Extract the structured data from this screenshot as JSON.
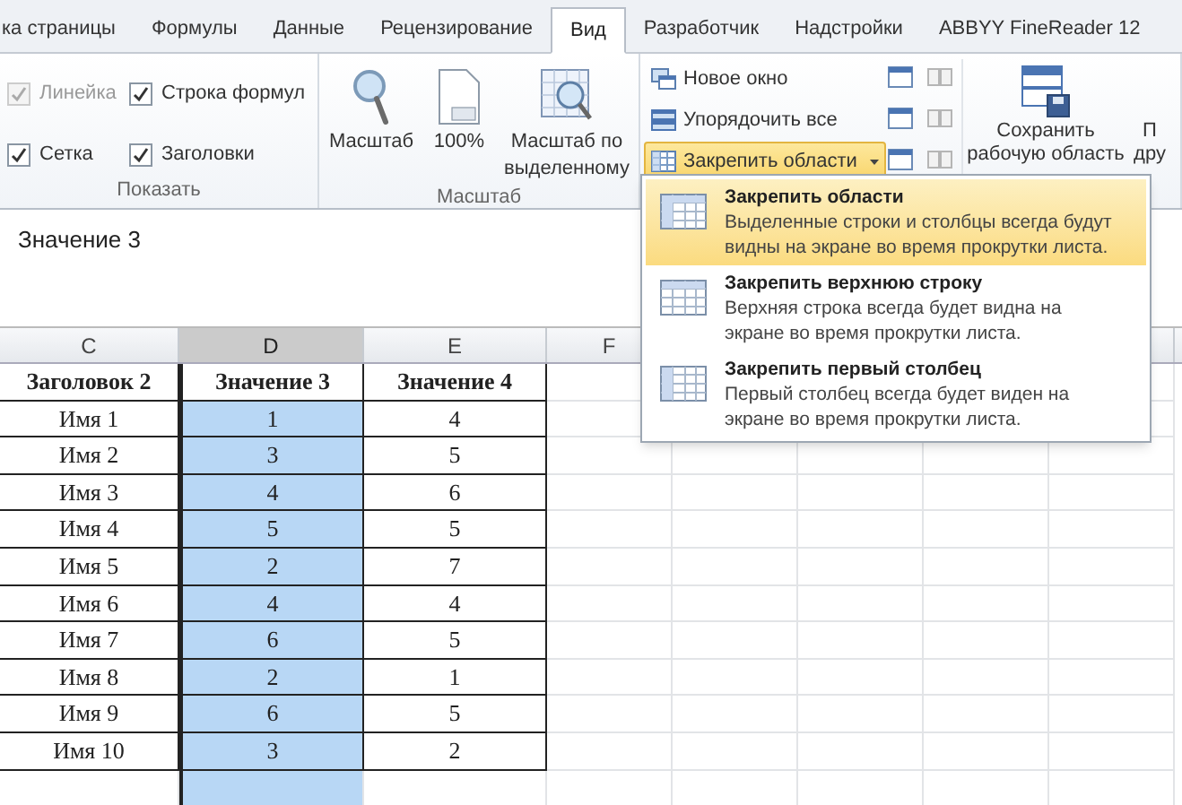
{
  "tabs": [
    {
      "label": "ка страницы",
      "selected": false
    },
    {
      "label": "Формулы",
      "selected": false
    },
    {
      "label": "Данные",
      "selected": false
    },
    {
      "label": "Рецензирование",
      "selected": false
    },
    {
      "label": "Вид",
      "selected": true
    },
    {
      "label": "Разработчик",
      "selected": false
    },
    {
      "label": "Надстройки",
      "selected": false
    },
    {
      "label": "ABBYY FineReader 12",
      "selected": false
    }
  ],
  "show_group": {
    "label": "Показать",
    "checkboxes": [
      {
        "label": "Линейка",
        "checked": true,
        "disabled": true
      },
      {
        "label": "Строка формул",
        "checked": true,
        "disabled": false
      },
      {
        "label": "Сетка",
        "checked": true,
        "disabled": false
      },
      {
        "label": "Заголовки",
        "checked": true,
        "disabled": false
      }
    ]
  },
  "zoom_group": {
    "label": "Масштаб",
    "buttons": [
      {
        "kind": "magnifier",
        "label": "Масштаб"
      },
      {
        "kind": "page",
        "label": "100%"
      },
      {
        "kind": "selection",
        "label": "Масштаб по выделенному"
      }
    ]
  },
  "window_group": {
    "buttons": [
      {
        "kind": "new-window",
        "label": "Новое окно",
        "pressed": false,
        "dropdown": false
      },
      {
        "kind": "arrange",
        "label": "Упорядочить все",
        "pressed": false,
        "dropdown": false
      },
      {
        "kind": "freeze",
        "label": "Закрепить области",
        "pressed": true,
        "dropdown": true
      }
    ],
    "large_buttons": [
      {
        "label": "Сохранить рабочую область"
      },
      {
        "label": "П дру"
      }
    ]
  },
  "formula_bar": {
    "value": "Значение 3"
  },
  "sheet": {
    "columns": [
      {
        "label": "C",
        "selected": false
      },
      {
        "label": "D",
        "selected": true
      },
      {
        "label": "E",
        "selected": false
      },
      {
        "label": "F",
        "selected": false
      }
    ],
    "rows": [
      {
        "kind": "header",
        "cells": [
          "Заголовок 2",
          "Значение 3",
          "Значение 4"
        ]
      },
      {
        "kind": "data",
        "cells": [
          "Имя 1",
          "1",
          "4"
        ]
      },
      {
        "kind": "data",
        "cells": [
          "Имя 2",
          "3",
          "5"
        ]
      },
      {
        "kind": "data",
        "cells": [
          "Имя 3",
          "4",
          "6"
        ]
      },
      {
        "kind": "data",
        "cells": [
          "Имя 4",
          "5",
          "5"
        ]
      },
      {
        "kind": "data",
        "cells": [
          "Имя 5",
          "2",
          "7"
        ]
      },
      {
        "kind": "data",
        "cells": [
          "Имя 6",
          "4",
          "4"
        ]
      },
      {
        "kind": "data",
        "cells": [
          "Имя 7",
          "6",
          "5"
        ]
      },
      {
        "kind": "data",
        "cells": [
          "Имя 8",
          "2",
          "1"
        ]
      },
      {
        "kind": "data",
        "cells": [
          "Имя 9",
          "6",
          "5"
        ]
      },
      {
        "kind": "data",
        "cells": [
          "Имя 10",
          "3",
          "2"
        ]
      },
      {
        "kind": "empty",
        "cells": []
      }
    ]
  },
  "menu": {
    "items": [
      {
        "title": "Закрепить области",
        "description": "Выделенные строки и столбцы всегда будут видны на экране во время прокрутки листа.",
        "selected": true
      },
      {
        "title": "Закрепить верхнюю строку",
        "description": "Верхняя строка всегда будет видна на экране во время прокрутки листа.",
        "selected": false
      },
      {
        "title": "Закрепить первый столбец",
        "description": "Первый столбец всегда будет виден на экране во время прокрутки листа.",
        "selected": false
      }
    ]
  }
}
